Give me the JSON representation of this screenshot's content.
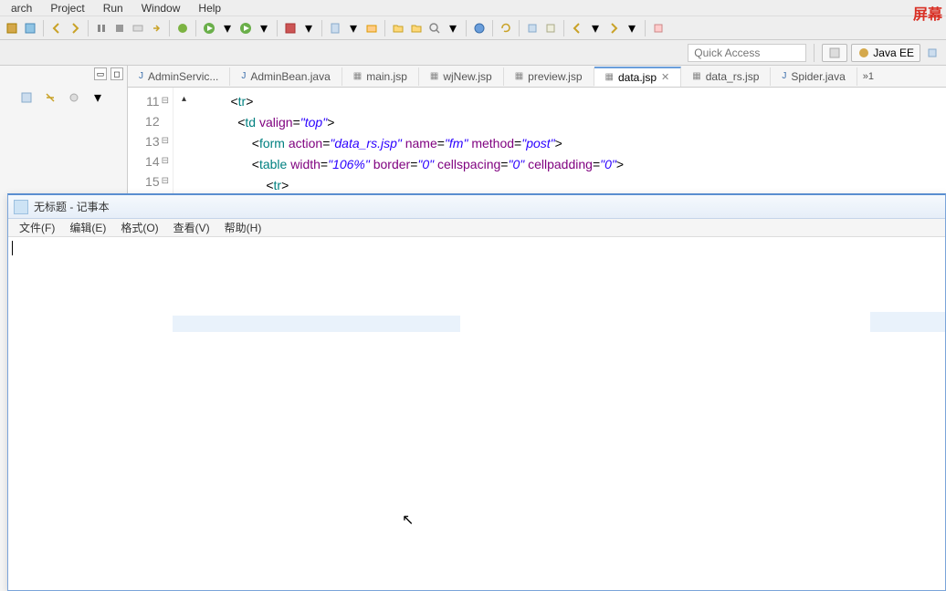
{
  "menu": {
    "items": [
      "arch",
      "Project",
      "Run",
      "Window",
      "Help"
    ]
  },
  "overlay_label": "屏幕",
  "toolbar_icons": [
    "open-type",
    "show-whitespace",
    "back",
    "forward",
    "pause",
    "stop",
    "breakpoint",
    "skip",
    "debug",
    "run",
    "run-last",
    "ext-tools",
    "new-server",
    "open-folder",
    "open-file",
    "search",
    "browser",
    "refresh"
  ],
  "quick_access_placeholder": "Quick Access",
  "perspective": {
    "active": "Java EE"
  },
  "editor": {
    "tabs": [
      {
        "label": "AdminServic...",
        "icon": "J"
      },
      {
        "label": "AdminBean.java",
        "icon": "J"
      },
      {
        "label": "main.jsp",
        "icon": "jsp"
      },
      {
        "label": "wjNew.jsp",
        "icon": "jsp"
      },
      {
        "label": "preview.jsp",
        "icon": "jsp"
      },
      {
        "label": "data.jsp",
        "icon": "jsp",
        "active": true
      },
      {
        "label": "data_rs.jsp",
        "icon": "jsp"
      },
      {
        "label": "Spider.java",
        "icon": "J"
      }
    ],
    "overflow": "»1",
    "lines": [
      {
        "num": "11",
        "fold": true
      },
      {
        "num": "12"
      },
      {
        "num": "13",
        "fold": true
      },
      {
        "num": "14",
        "fold": true
      },
      {
        "num": "15",
        "fold": true
      }
    ],
    "code": {
      "t": {
        "tr": "tr",
        "td": "td",
        "form": "form",
        "table": "table"
      },
      "a": {
        "valign": "valign",
        "action": "action",
        "name": "name",
        "method": "method",
        "width": "width",
        "border": "border",
        "cellspacing": "cellspacing",
        "cellpadding": "cellpadding"
      },
      "v": {
        "top": "\"top\"",
        "datars": "\"data_rs.jsp\"",
        "fm": "\"fm\"",
        "post": "\"post\"",
        "w106": "\"106%\"",
        "zero": "\"0\""
      }
    }
  },
  "notepad": {
    "title": "无标题 - 记事本",
    "menu": [
      "文件(F)",
      "编辑(E)",
      "格式(O)",
      "查看(V)",
      "帮助(H)"
    ]
  }
}
